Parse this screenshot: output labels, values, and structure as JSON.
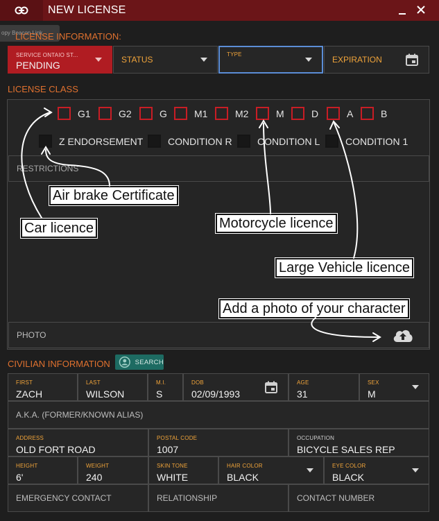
{
  "window": {
    "title": "NEW LICENSE",
    "ghost_tab": "opy Beacon Link"
  },
  "sections": {
    "license_information": "LICENSE INFORMATION:",
    "license_class": "LICENSE CLASS",
    "civilian_information": "CIVILIAN INFORMATION"
  },
  "license_info": {
    "service_label": "SERVICE ONTAIO ST...",
    "service_value": "PENDING",
    "status_label": "STATUS",
    "type_label": "TYPE",
    "expiration_label": "EXPIRATION"
  },
  "license_classes": {
    "row1": [
      "G1",
      "G2",
      "G",
      "M1",
      "M2",
      "M",
      "D",
      "A",
      "B"
    ],
    "row2": [
      "Z ENDORSEMENT",
      "CONDITION R",
      "CONDITION L",
      "CONDITION 1"
    ]
  },
  "restrictions_label": "RESTRICTIONS",
  "photo_label": "PHOTO",
  "annotations": {
    "air_brake": "Air brake Certificate",
    "car": "Car licence",
    "motorcycle": "Motorcycle licence",
    "large_vehicle": "Large Vehicle licence",
    "photo": "Add a photo of your character"
  },
  "search_label": "SEARCH",
  "civilian": {
    "first": {
      "label": "FIRST",
      "value": "ZACH"
    },
    "last": {
      "label": "LAST",
      "value": "WILSON"
    },
    "mi": {
      "label": "M.I.",
      "value": "S"
    },
    "dob": {
      "label": "DOB",
      "value": "02/09/1993"
    },
    "age": {
      "label": "AGE",
      "value": "31"
    },
    "sex": {
      "label": "SEX",
      "value": "M"
    },
    "aka": {
      "label": "A.K.A. (FORMER/KNOWN ALIAS)"
    },
    "address": {
      "label": "ADDRESS",
      "value": "OLD FORT ROAD"
    },
    "postal": {
      "label": "POSTAL CODE",
      "value": "1007"
    },
    "occupation": {
      "label": "OCCUPATION",
      "value": "BICYCLE SALES REP"
    },
    "height": {
      "label": "HEIGHT",
      "value": "6'"
    },
    "weight": {
      "label": "WEIGHT",
      "value": "240"
    },
    "skin": {
      "label": "SKIN TONE",
      "value": "WHITE"
    },
    "hair": {
      "label": "HAIR COLOR",
      "value": "BLACK"
    },
    "eye": {
      "label": "EYE COLOR",
      "value": "BLACK"
    },
    "emergency": {
      "label": "EMERGENCY CONTACT"
    },
    "relationship": {
      "label": "RELATIONSHIP"
    },
    "contact_number": {
      "label": "CONTACT NUMBER"
    }
  },
  "colors": {
    "accent": "#e0712f",
    "titlebar": "#6b1518",
    "checkbox": "#c81d25",
    "focus": "#5b8dd6",
    "search": "#1d6b62"
  },
  "icons": [
    "link-icon",
    "minimize-icon",
    "close-icon",
    "calendar-icon",
    "caret-down-icon",
    "cloud-upload-icon",
    "person-search-icon"
  ]
}
